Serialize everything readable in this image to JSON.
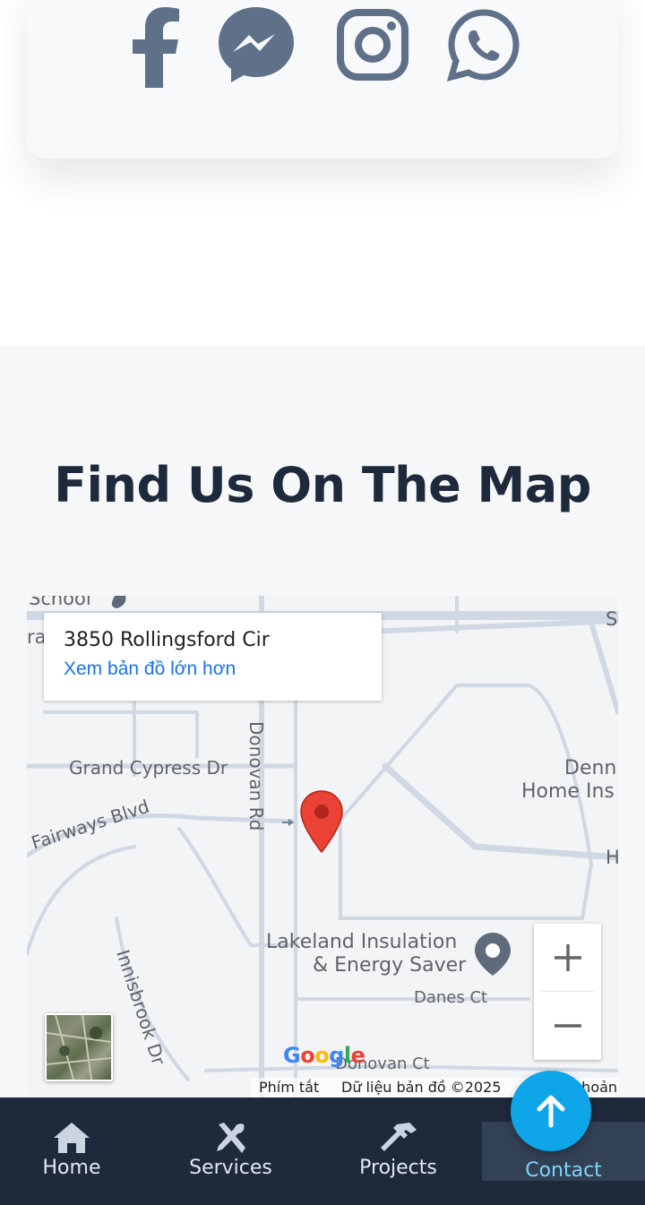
{
  "social": {
    "icons": [
      "facebook-icon",
      "messenger-icon",
      "instagram-icon",
      "whatsapp-icon"
    ],
    "icon_color": "#5f7089"
  },
  "map_section": {
    "title": "Find Us On The Map",
    "info_card": {
      "address": "3850 Rollingsford Cir",
      "link": "Xem bản đồ lớn hơn"
    },
    "labels": {
      "school": "School",
      "grand_cypress": "Grand Cypress Dr",
      "fairways": "Fairways Blvd",
      "innisbrook": "Innisbrook Dr",
      "donovan_rd": "Donovan Rd",
      "denn": "Denn",
      "home_ins": "Home Ins",
      "lakeland_line1": "Lakeland Insulation",
      "lakeland_line2": "& Energy Saver",
      "danes_ct": "Danes Ct",
      "donovan_ct": "Donovan Ct",
      "h_label": "H",
      "s_label": "S",
      "ra_label": "ra"
    },
    "google_logo": "Google",
    "footer": {
      "shortcuts": "Phím tắt",
      "data": "Dữ liệu bản đồ ©2025",
      "terms": "Điều khoản"
    },
    "zoom_in": "+",
    "zoom_out": "−"
  },
  "bottom_nav": {
    "items": [
      {
        "label": "Home",
        "icon": "home-icon"
      },
      {
        "label": "Services",
        "icon": "tools-icon"
      },
      {
        "label": "Projects",
        "icon": "hammer-icon"
      },
      {
        "label": "Contact",
        "icon": "contact-icon"
      }
    ],
    "active": "Contact",
    "background": "#1e293b",
    "active_color": "#7dd3fc"
  },
  "scroll_top": {
    "icon": "arrow-up-icon",
    "color": "#0ea5e9"
  }
}
